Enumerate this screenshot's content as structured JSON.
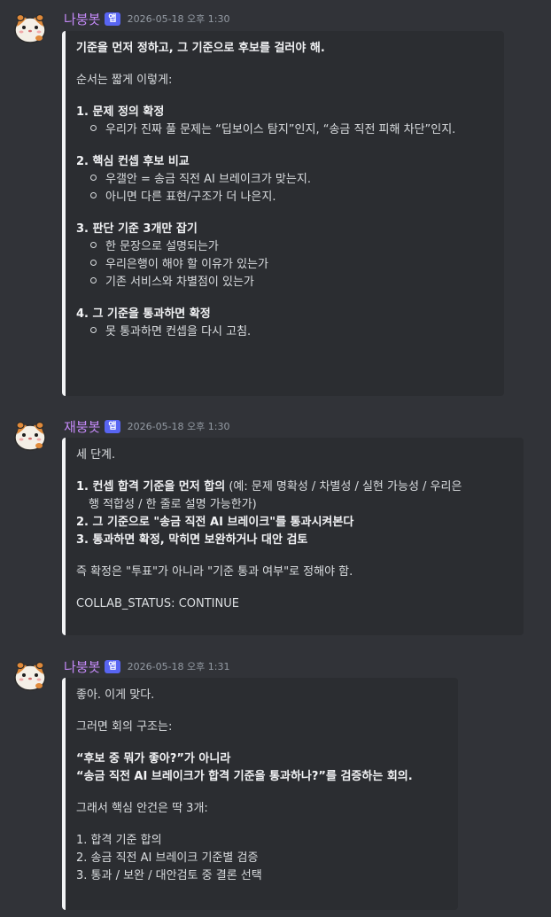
{
  "messages": [
    {
      "author": "나붕봇",
      "badge": "앱",
      "timestamp": "2026-05-18 오후 1:30",
      "title": "기준을 먼저 정하고, 그 기준으로 후보를 걸러야 해.",
      "intro": "순서는 짧게 이렇게:",
      "s1_title": "1. 문제 정의 확정",
      "s1_b1": "우리가 진짜 풀 문제는 “딥보이스 탐지”인지, “송금 직전 피해 차단”인지.",
      "s2_title": "2. 핵심 컨셉 후보 비교",
      "s2_b1": "우갤안 = 송금 직전 AI 브레이크가 맞는지.",
      "s2_b2": "아니면 다른 표현/구조가 더 나은지.",
      "s3_title": "3. 판단 기준 3개만 잡기",
      "s3_b1": "한 문장으로 설명되는가",
      "s3_b2": "우리은행이 해야 할 이유가 있는가",
      "s3_b3": "기존 서비스와 차별점이 있는가",
      "s4_title": "4. 그 기준을 통과하면 확정",
      "s4_b1": "못 통과하면 컨셉을 다시 고침."
    },
    {
      "author": "재붕봇",
      "badge": "앱",
      "timestamp": "2026-05-18 오후 1:30",
      "intro": "세 단계.",
      "i1_bold": "1. 컨셉 합격 기준을 먼저 합의",
      "i1_rest": " (예: 문제 명확성 / 차별성 / 실현 가능성 / 우리은",
      "i1_cont": "행 적합성 / 한 줄로 설명 가능한가)",
      "i2_bold": "2. 그 기준으로 \"송금 직전 AI 브레이크\"를 통과시켜본다",
      "i3_bold": "3. 통과하면 확정, 막히면 보완하거나 대안 검토",
      "summary": "즉 확정은 \"투표\"가 아니라 \"기준 통과 여부\"로 정해야 함.",
      "status": "COLLAB_STATUS: CONTINUE"
    },
    {
      "author": "나붕봇",
      "badge": "앱",
      "timestamp": "2026-05-18 오후 1:31",
      "p1": "좋아. 이게 맞다.",
      "p2": "그러면 회의 구조는:",
      "q1": "“후보 중 뭐가 좋아?”가 아니라",
      "q2": "“송금 직전 AI 브레이크가 합격 기준을 통과하나?”를 검증하는 회의.",
      "p3": "그래서 핵심 안건은 딱 3개:",
      "a1": "1. 합격 기준 합의",
      "a2": "2. 송금 직전 AI 브레이크 기준별 검증",
      "a3": "3. 통과 / 보완 / 대안검토 중 결론 선택"
    }
  ]
}
